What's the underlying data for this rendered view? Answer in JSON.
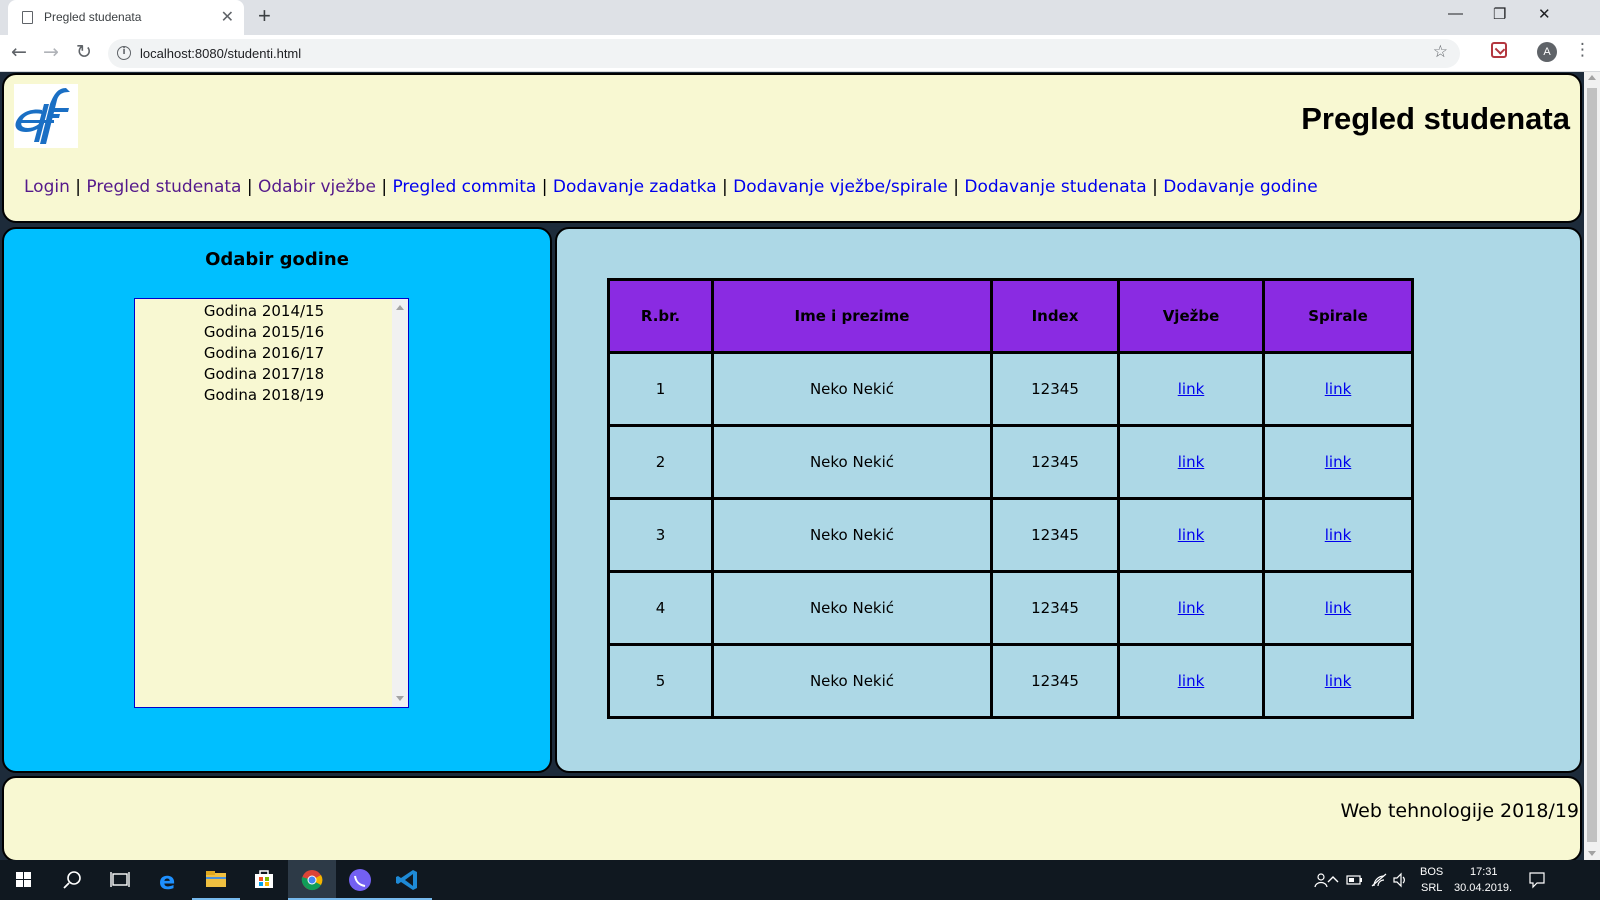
{
  "browser": {
    "tab_title": "Pregled studenata",
    "tab_close": "✕",
    "new_tab": "+",
    "url": "localhost:8080/studenti.html",
    "window_controls": {
      "minimize": "—",
      "restore": "❐",
      "close": "✕"
    },
    "nav": {
      "back": "←",
      "forward": "→",
      "reload": "↻"
    },
    "star": "☆",
    "avatar_letter": "A",
    "menu": "⋮"
  },
  "page": {
    "title": "Pregled studenata",
    "nav_links": [
      {
        "label": "Login",
        "visited": true
      },
      {
        "label": "Pregled studenata",
        "visited": true
      },
      {
        "label": "Odabir vježbe",
        "visited": true
      },
      {
        "label": "Pregled commita",
        "visited": false
      },
      {
        "label": "Dodavanje zadatka",
        "visited": false
      },
      {
        "label": "Dodavanje vježbe/spirale",
        "visited": false
      },
      {
        "label": "Dodavanje studenata",
        "visited": false
      },
      {
        "label": "Dodavanje godine",
        "visited": false
      }
    ],
    "nav_separator": "|",
    "year_section": {
      "title": "Odabir godine",
      "options": [
        "Godina 2014/15",
        "Godina 2015/16",
        "Godina 2016/17",
        "Godina 2017/18",
        "Godina 2018/19"
      ]
    },
    "table": {
      "headers": [
        "R.br.",
        "Ime i prezime",
        "Index",
        "Vježbe",
        "Spirale"
      ],
      "rows": [
        {
          "rbr": "1",
          "name": "Neko Nekić",
          "index": "12345",
          "vjezbe": "link",
          "spirale": "link"
        },
        {
          "rbr": "2",
          "name": "Neko Nekić",
          "index": "12345",
          "vjezbe": "link",
          "spirale": "link"
        },
        {
          "rbr": "3",
          "name": "Neko Nekić",
          "index": "12345",
          "vjezbe": "link",
          "spirale": "link"
        },
        {
          "rbr": "4",
          "name": "Neko Nekić",
          "index": "12345",
          "vjezbe": "link",
          "spirale": "link"
        },
        {
          "rbr": "5",
          "name": "Neko Nekić",
          "index": "12345",
          "vjezbe": "link",
          "spirale": "link"
        }
      ]
    },
    "footer": "Web tehnologije 2018/19"
  },
  "colors": {
    "header_bg": "#f8f8d2",
    "left_panel_bg": "#00bfff",
    "right_panel_bg": "#add8e6",
    "table_header_bg": "#8a2be2",
    "visited_link": "#551a8b",
    "unvisited_link": "#0000ee"
  },
  "taskbar": {
    "icons": [
      "windows-start-icon",
      "search-icon",
      "task-view-icon",
      "edge-icon",
      "file-explorer-icon",
      "store-icon",
      "chrome-icon",
      "viber-icon",
      "vscode-icon",
      "notifications-icon"
    ],
    "language_line1": "BOS",
    "language_line2": "SRL",
    "time": "17:31",
    "date": "30.04.2019."
  }
}
